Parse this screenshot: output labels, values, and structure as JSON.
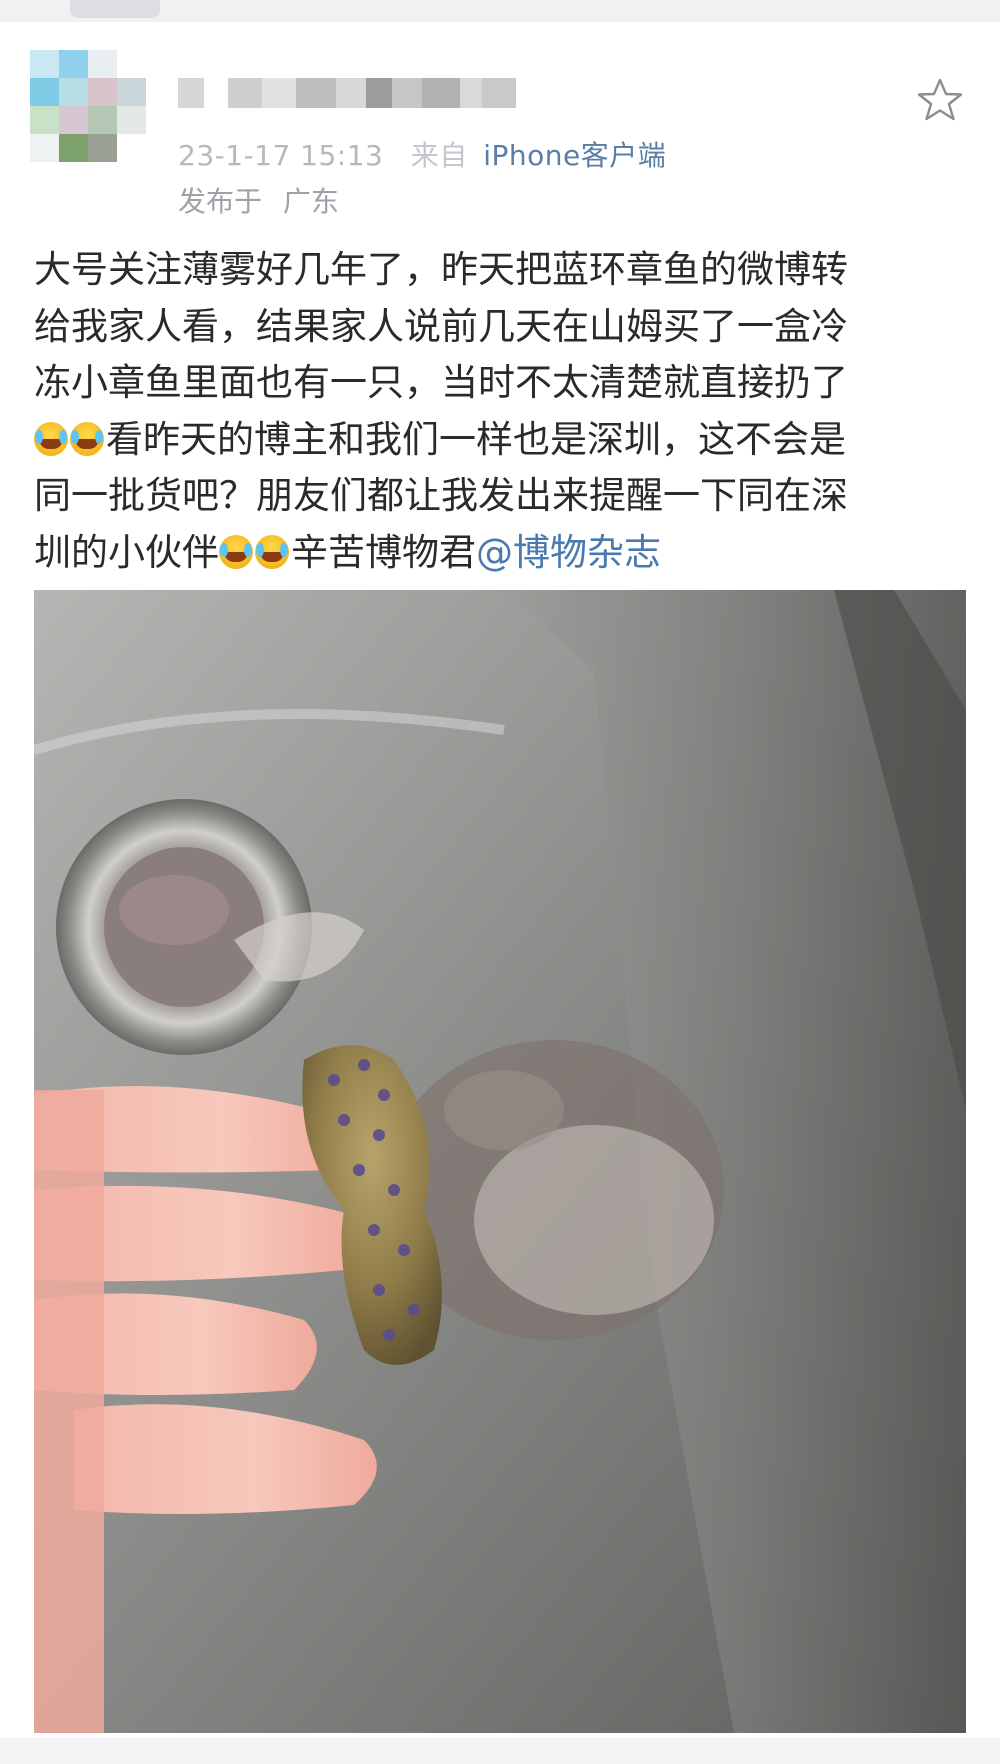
{
  "post": {
    "timestamp": "23-1-17 15:13",
    "source_prefix": "来自",
    "source_client": "iPhone客户端",
    "location_prefix": "发布于",
    "location": "广东",
    "lines": [
      "大号关注薄雾好几年了，昨天把蓝环章鱼的微博转",
      "给我家人看，结果家人说前几天在山姆买了一盒冷",
      "冻小章鱼里面也有一只，当时不太清楚就直接扔了",
      "看昨天的博主和我们一样也是深圳，这不会是",
      "同一批货吧？朋友们都让我发出来提醒一下同在深",
      "圳的小伙伴",
      "辛苦博物君",
      "@博物杂志"
    ],
    "emoji_name": "crying-laughing-emoji"
  },
  "icons": {
    "favorite": "star-outline-icon"
  },
  "colors": {
    "meta_text": "#9ea1a8",
    "link": "#4a78b0",
    "body_text": "#2a2a2a"
  }
}
